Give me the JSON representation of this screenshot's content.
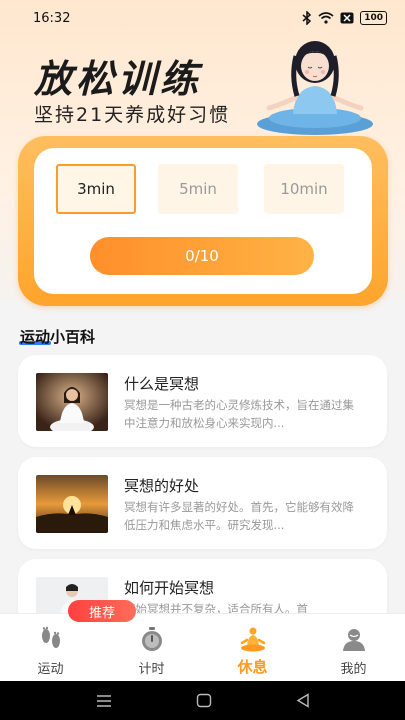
{
  "status_bar": {
    "time": "16:32",
    "battery": "100"
  },
  "hero": {
    "title": "放松训练",
    "subtitle": "坚持21天养成好习惯"
  },
  "timer": {
    "durations": [
      {
        "label": "3min",
        "selected": true
      },
      {
        "label": "5min",
        "selected": false
      },
      {
        "label": "10min",
        "selected": false
      }
    ],
    "progress_label": "0/10"
  },
  "section": {
    "title": "运动小百科"
  },
  "articles": [
    {
      "title": "什么是冥想",
      "desc": "冥想是一种古老的心灵修炼技术，旨在通过集中注意力和放松身心来实现内..."
    },
    {
      "title": "冥想的好处",
      "desc": "冥想有许多显著的好处。首先，它能够有效降低压力和焦虑水平。研究发现..."
    },
    {
      "title": "如何开始冥想",
      "desc": "开始冥想并不复杂，适合所有人。首"
    }
  ],
  "badge": {
    "label": "推荐"
  },
  "tabs": [
    {
      "label": "运动",
      "icon": "footprints-icon",
      "active": false
    },
    {
      "label": "计时",
      "icon": "stopwatch-icon",
      "active": false
    },
    {
      "label": "休息",
      "icon": "meditation-icon",
      "active": true
    },
    {
      "label": "我的",
      "icon": "profile-icon",
      "active": false
    }
  ],
  "colors": {
    "accent": "#ff9a1f",
    "card_orange": "#ffa42c",
    "badge_red": "#ff4040",
    "underline_blue": "#2a7df5"
  }
}
